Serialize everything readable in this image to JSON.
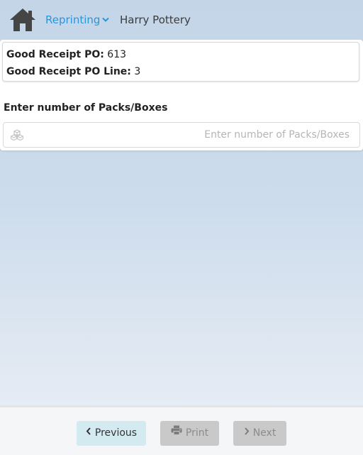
{
  "header": {
    "home_icon": "home-icon",
    "menu_label": "Reprinting",
    "menu_icon": "chevron-down-icon",
    "user_name": "Harry Pottery",
    "accent_color": "#2d96d8"
  },
  "info": {
    "po_label": "Good Receipt PO:",
    "po_value": "613",
    "po_line_label": "Good Receipt PO Line:",
    "po_line_value": "3"
  },
  "packs_field": {
    "label": "Enter number of Packs/Boxes",
    "placeholder": "Enter number of Packs/Boxes",
    "value": "",
    "icon": "boxes-icon"
  },
  "footer": {
    "previous_label": "Previous",
    "previous_icon": "chevron-left-icon",
    "print_label": "Print",
    "print_icon": "printer-icon",
    "next_label": "Next",
    "next_icon": "chevron-right-icon"
  }
}
